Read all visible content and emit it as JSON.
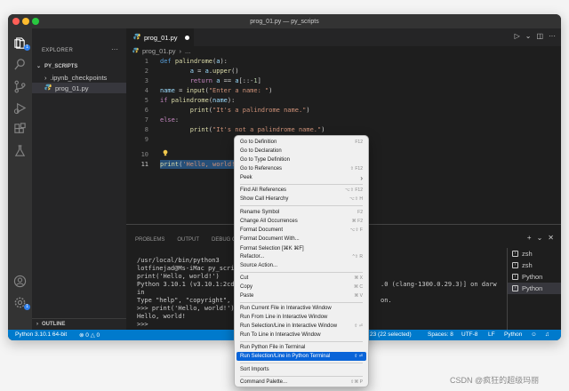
{
  "window": {
    "title": "prog_01.py — py_scripts"
  },
  "sidebar": {
    "title": "EXPLORER",
    "more": "···",
    "folder": "PY_SCRIPTS",
    "items": [
      {
        "label": ".ipynb_checkpoints"
      },
      {
        "label": "prog_01.py"
      }
    ],
    "outline": "OUTLINE"
  },
  "activity": {
    "badge": "1",
    "settings_badge": "1"
  },
  "tabs": {
    "active_label": "prog_01.py",
    "more": "···"
  },
  "breadcrumb": {
    "file": "prog_01.py",
    "more": "..."
  },
  "editor": {
    "line_numbers": [
      "1",
      "2",
      "3",
      "4",
      "5",
      "6",
      "7",
      "8",
      "9",
      "10",
      "11"
    ]
  },
  "panel": {
    "tabs": [
      "PROBLEMS",
      "OUTPUT",
      "DEBUG CO"
    ],
    "plus": "+",
    "terminal_lines": [
      "/usr/local/bin/python3",
      "lotfinejad@Ms-iMac py_scripts",
      "print('Hello, world!')",
      "Python 3.10.1 (v3.10.1:2cd268",
      "in",
      "Type \"help\", \"copyright\", \"cr",
      ">>> print('Hello, world!')",
      "Hello, world!",
      ">>>"
    ],
    "terminal_tail_1": ".0 (clang-1300.0.29.3)] on darw",
    "terminal_tail_2": "on.",
    "terminals": [
      "zsh",
      "zsh",
      "Python",
      "Python"
    ]
  },
  "statusbar": {
    "interpreter": "Python 3.10.1 64-bit",
    "errors": "0",
    "warnings": "0",
    "selection": "23 (22 selected)",
    "spaces": "Spaces: 8",
    "encoding": "UTF-8",
    "eol": "LF",
    "language": "Python"
  },
  "context_menu": {
    "items": [
      {
        "label": "Go to Definition",
        "shortcut": "F12"
      },
      {
        "label": "Go to Declaration",
        "shortcut": ""
      },
      {
        "label": "Go to Type Definition",
        "shortcut": ""
      },
      {
        "label": "Go to References",
        "shortcut": "⇧ F12"
      },
      {
        "label": "Peek",
        "shortcut": "›"
      },
      {
        "label": "Find All References",
        "shortcut": "⌥⇧ F12"
      },
      {
        "label": "Show Call Hierarchy",
        "shortcut": "⌥⇧ H"
      },
      {
        "label": "Rename Symbol",
        "shortcut": "F2"
      },
      {
        "label": "Change All Occurrences",
        "shortcut": "⌘ F2"
      },
      {
        "label": "Format Document",
        "shortcut": "⌥⇧ F"
      },
      {
        "label": "Format Document With...",
        "shortcut": ""
      },
      {
        "label": "Format Selection [⌘K ⌘F]",
        "shortcut": ""
      },
      {
        "label": "Refactor...",
        "shortcut": "^⇧ R"
      },
      {
        "label": "Source Action...",
        "shortcut": ""
      },
      {
        "label": "Cut",
        "shortcut": "⌘ X"
      },
      {
        "label": "Copy",
        "shortcut": "⌘ C"
      },
      {
        "label": "Paste",
        "shortcut": "⌘ V"
      },
      {
        "label": "Run Current File in Interactive Window",
        "shortcut": ""
      },
      {
        "label": "Run From Line in Interactive Window",
        "shortcut": ""
      },
      {
        "label": "Run Selection/Line in Interactive Window",
        "shortcut": "⇧ ⏎"
      },
      {
        "label": "Run To Line in Interactive Window",
        "shortcut": ""
      },
      {
        "label": "Run Python File in Terminal",
        "shortcut": ""
      },
      {
        "label": "Run Selection/Line in Python Terminal",
        "shortcut": "⇧ ⏎"
      },
      {
        "label": "Sort Imports",
        "shortcut": ""
      },
      {
        "label": "Command Palette...",
        "shortcut": "⇧⌘ P"
      }
    ],
    "selected_label": "Run Selection/Line in Python Terminal"
  },
  "watermark": "CSDN @疯狂的超级玛丽",
  "colors": {
    "accent": "#007acc",
    "menu_highlight": "#0a64d8",
    "editor_bg": "#1e1e1e"
  }
}
